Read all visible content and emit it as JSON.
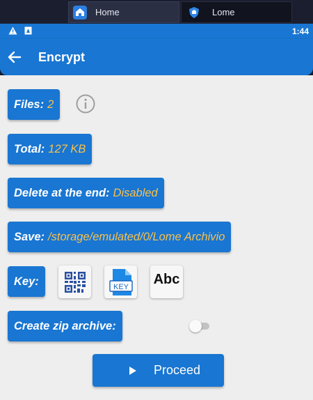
{
  "emulator": {
    "tabs": [
      {
        "label": "Home",
        "icon": "home-icon",
        "active": true
      },
      {
        "label": "Lome",
        "icon": "lome-shield-icon",
        "active": false
      }
    ]
  },
  "status_bar": {
    "icons": [
      "warning-icon",
      "notification-icon"
    ],
    "time": "1:44"
  },
  "app_bar": {
    "title": "Encrypt",
    "back_icon": "arrow-left-icon"
  },
  "info": {
    "files_label": "Files:",
    "files_value": "2",
    "total_label": "Total:",
    "total_value": "127 KB",
    "delete_label": "Delete at the end:",
    "delete_value": "Disabled",
    "save_label": "Save:",
    "save_value": "/storage/emulated/0/Lome Archivio"
  },
  "key": {
    "label": "Key:",
    "options": [
      {
        "icon": "qr-code-icon"
      },
      {
        "icon": "key-file-icon",
        "text": "KEY"
      },
      {
        "icon": "abc-text-icon",
        "text": "Abc"
      }
    ]
  },
  "zip": {
    "label": "Create zip archive:",
    "enabled": false
  },
  "proceed": {
    "label": "Proceed",
    "icon": "play-icon"
  },
  "colors": {
    "primary": "#1976d2",
    "value_accent": "#f6c04f",
    "background": "#eeeeee"
  }
}
